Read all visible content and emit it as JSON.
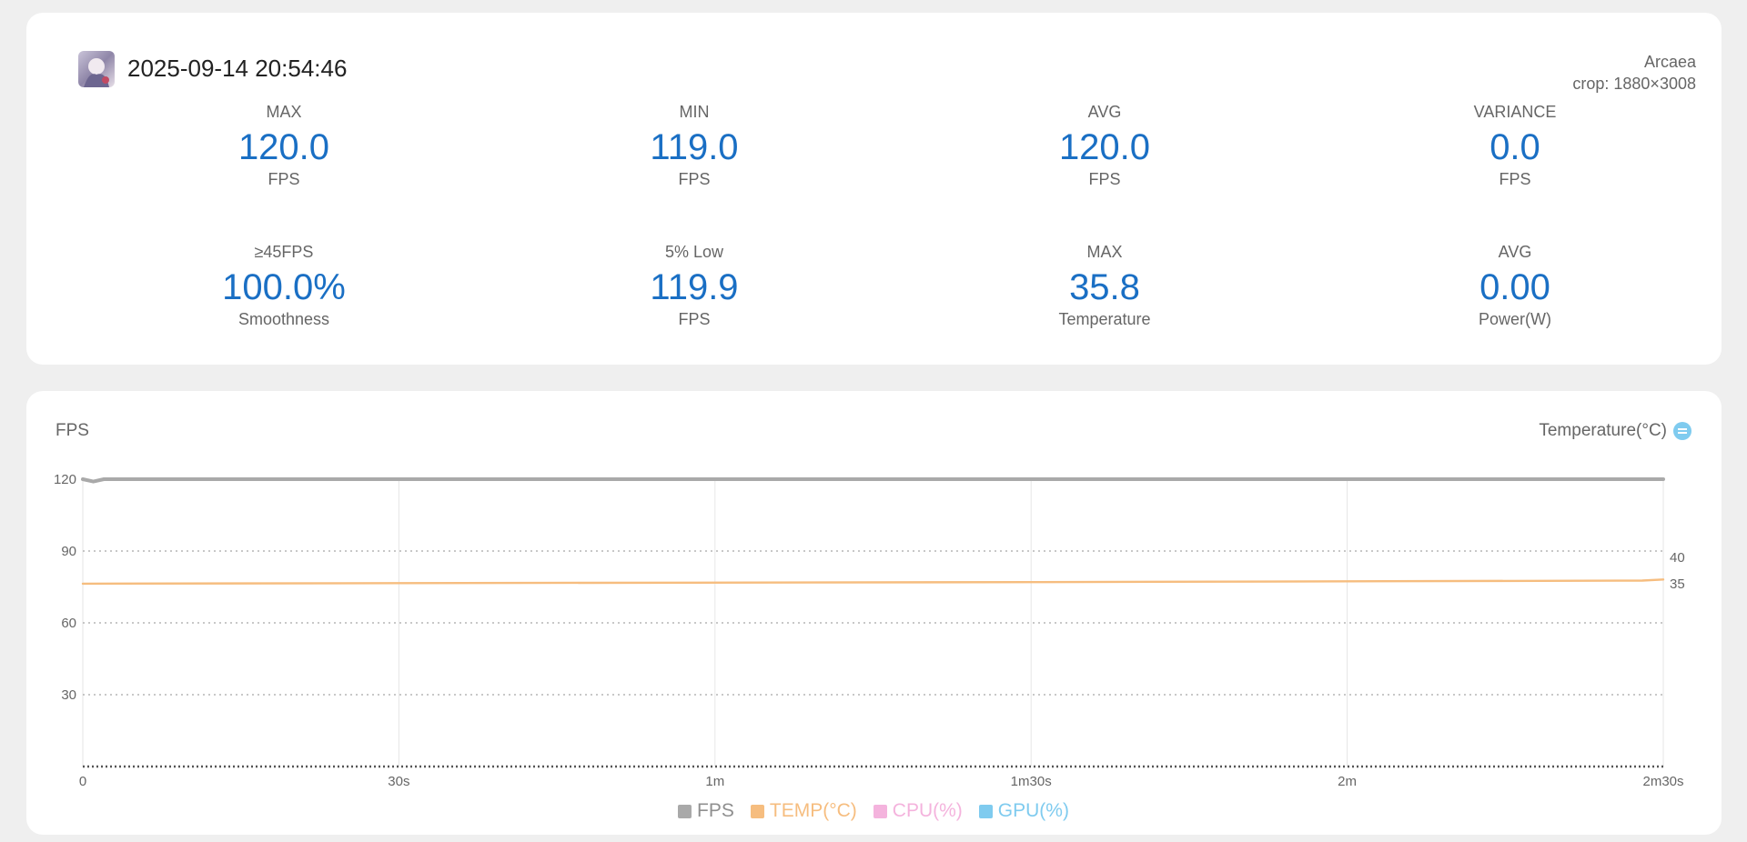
{
  "header": {
    "session_time": "2025-09-14 20:54:46",
    "app_name": "Arcaea",
    "crop": "crop: 1880×3008"
  },
  "stats": [
    {
      "label": "MAX",
      "value": "120.0",
      "unit": "FPS"
    },
    {
      "label": "MIN",
      "value": "119.0",
      "unit": "FPS"
    },
    {
      "label": "AVG",
      "value": "120.0",
      "unit": "FPS"
    },
    {
      "label": "VARIANCE",
      "value": "0.0",
      "unit": "FPS"
    },
    {
      "label": "≥45FPS",
      "value": "100.0%",
      "unit": "Smoothness"
    },
    {
      "label": "5% Low",
      "value": "119.9",
      "unit": "FPS"
    },
    {
      "label": "MAX",
      "value": "35.8",
      "unit": "Temperature"
    },
    {
      "label": "AVG",
      "value": "0.00",
      "unit": "Power(W)"
    }
  ],
  "chart": {
    "left_axis_title": "FPS",
    "right_axis_title": "Temperature(°C)",
    "swap_icon": "swap-axis-icon"
  },
  "colors": {
    "accent": "#1a6fc4",
    "fps": "#a9a9a9",
    "temp": "#f6bd7f",
    "cpu": "#f4b3dd",
    "gpu": "#7fcbef"
  },
  "chart_data": {
    "type": "line",
    "x_ticks": [
      "0",
      "30s",
      "1m",
      "1m30s",
      "2m",
      "2m30s"
    ],
    "xlim": [
      0,
      150
    ],
    "y_left_ticks": [
      "120",
      "90",
      "60",
      "30"
    ],
    "ylim_left": [
      0,
      120
    ],
    "y_right_ticks": [
      "40",
      "35"
    ],
    "ylim_right": [
      0,
      55
    ],
    "series": [
      {
        "name": "FPS",
        "axis": "left",
        "x": [
          0,
          1,
          2,
          150
        ],
        "y": [
          120,
          119,
          120,
          120
        ]
      },
      {
        "name": "TEMP(°C)",
        "axis": "right",
        "x": [
          0,
          30,
          90,
          148,
          150
        ],
        "y": [
          35.0,
          35.1,
          35.3,
          35.6,
          35.8
        ]
      },
      {
        "name": "CPU(%)",
        "axis": "left",
        "x": [],
        "y": []
      },
      {
        "name": "GPU(%)",
        "axis": "left",
        "x": [],
        "y": []
      }
    ],
    "legend_position": "bottom-center",
    "grid": true
  }
}
